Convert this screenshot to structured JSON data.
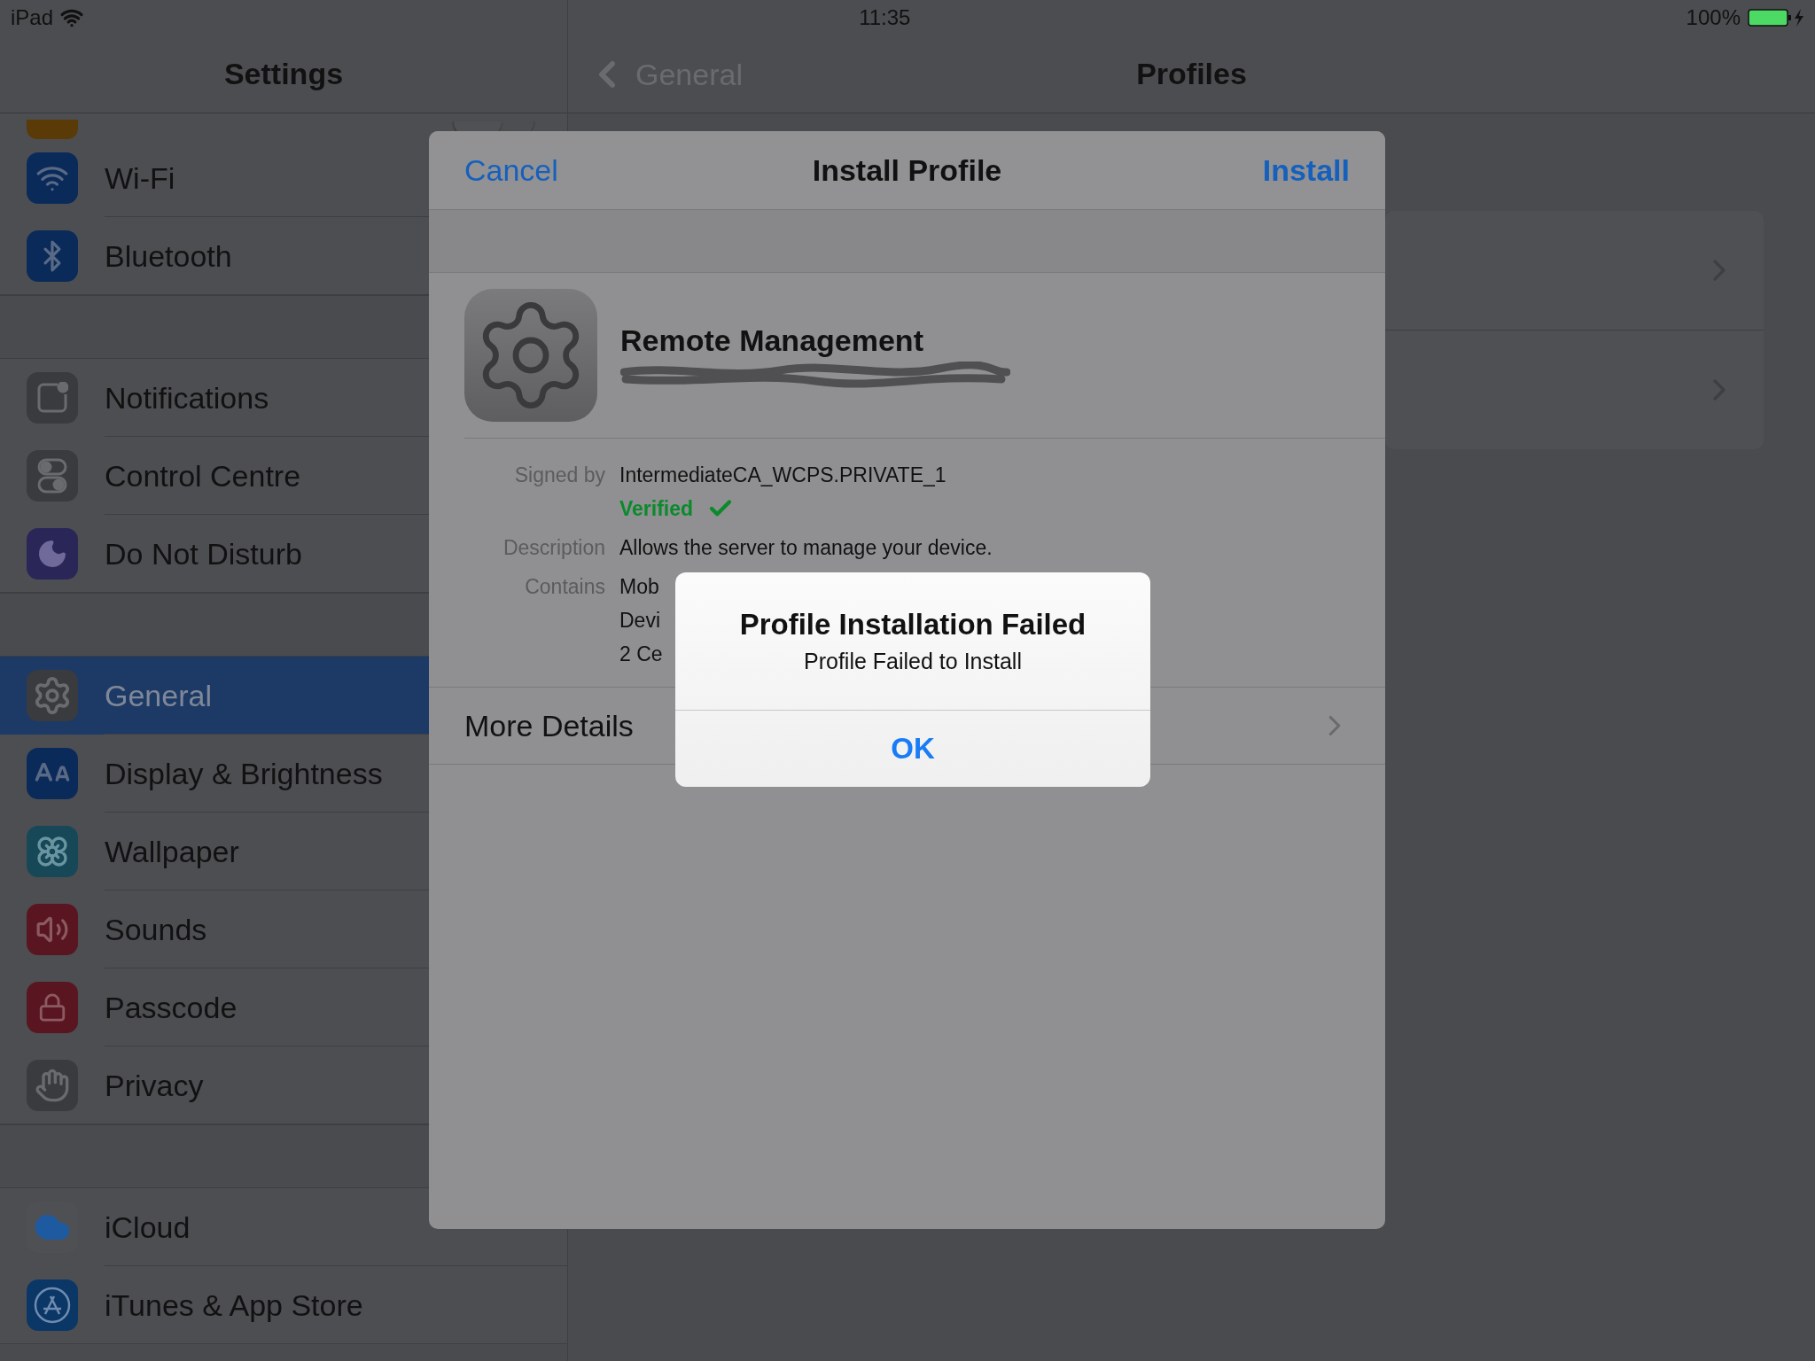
{
  "status_bar": {
    "device": "iPad",
    "time": "11:35",
    "battery": "100%"
  },
  "sidebar": {
    "title": "Settings",
    "partial_row": {
      "toggle_on": false
    },
    "groups": [
      [
        {
          "label": "Wi-Fi",
          "selected": false,
          "color": "#0a2a5a"
        },
        {
          "label": "Bluetooth",
          "selected": false,
          "color": "#0a2a5a"
        }
      ],
      [
        {
          "label": "Notifications",
          "selected": false,
          "color": "#3a3b3e"
        },
        {
          "label": "Control Centre",
          "selected": false,
          "color": "#3a3b3e"
        },
        {
          "label": "Do Not Disturb",
          "selected": false,
          "color": "#2a2658"
        }
      ],
      [
        {
          "label": "General",
          "selected": true,
          "color": "#3a3b3e"
        },
        {
          "label": "Display & Brightness",
          "selected": false,
          "color": "#0a2a5a"
        },
        {
          "label": "Wallpaper",
          "selected": false,
          "color": "#164858"
        },
        {
          "label": "Sounds",
          "selected": false,
          "color": "#5a1620"
        },
        {
          "label": "Passcode",
          "selected": false,
          "color": "#5a1620"
        },
        {
          "label": "Privacy",
          "selected": false,
          "color": "#3a3b3e"
        }
      ],
      [
        {
          "label": "iCloud",
          "selected": false,
          "color": "#4f5054"
        },
        {
          "label": "iTunes & App Store",
          "selected": false,
          "color": "#0b3766"
        }
      ]
    ]
  },
  "detail": {
    "back": "General",
    "title": "Profiles"
  },
  "sheet": {
    "cancel": "Cancel",
    "title": "Install Profile",
    "install": "Install",
    "profile_name": "Remote Management",
    "details": [
      {
        "label": "Signed by",
        "values": [
          {
            "text": "IntermediateCA_WCPS.PRIVATE_1",
            "kind": "plain"
          },
          {
            "text": "Verified",
            "kind": "verified"
          }
        ]
      },
      {
        "label": "Description",
        "values": [
          {
            "text": "Allows the server to manage your device.",
            "kind": "plain"
          }
        ]
      },
      {
        "label": "Contains",
        "values": [
          {
            "text": "Mob",
            "kind": "plain"
          },
          {
            "text": "Devi",
            "kind": "plain"
          },
          {
            "text": "2 Ce",
            "kind": "plain"
          }
        ]
      }
    ],
    "more": "More Details"
  },
  "alert": {
    "title": "Profile Installation Failed",
    "message": "Profile Failed to Install",
    "button": "OK"
  }
}
